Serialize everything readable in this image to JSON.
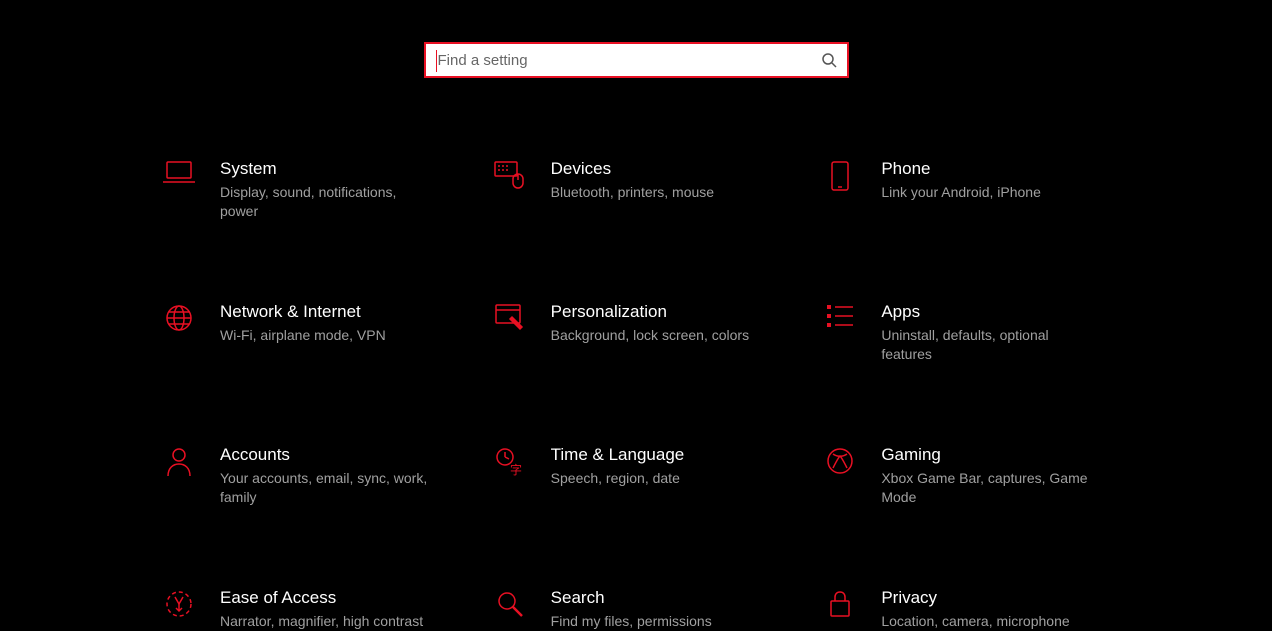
{
  "search": {
    "placeholder": "Find a setting"
  },
  "items": [
    {
      "title": "System",
      "desc": "Display, sound, notifications, power",
      "icon": "laptop"
    },
    {
      "title": "Devices",
      "desc": "Bluetooth, printers, mouse",
      "icon": "devices"
    },
    {
      "title": "Phone",
      "desc": "Link your Android, iPhone",
      "icon": "phone"
    },
    {
      "title": "Network & Internet",
      "desc": "Wi-Fi, airplane mode, VPN",
      "icon": "globe"
    },
    {
      "title": "Personalization",
      "desc": "Background, lock screen, colors",
      "icon": "personalize"
    },
    {
      "title": "Apps",
      "desc": "Uninstall, defaults, optional features",
      "icon": "apps"
    },
    {
      "title": "Accounts",
      "desc": "Your accounts, email, sync, work, family",
      "icon": "account"
    },
    {
      "title": "Time & Language",
      "desc": "Speech, region, date",
      "icon": "time-lang"
    },
    {
      "title": "Gaming",
      "desc": "Xbox Game Bar, captures, Game Mode",
      "icon": "gaming"
    },
    {
      "title": "Ease of Access",
      "desc": "Narrator, magnifier, high contrast",
      "icon": "ease"
    },
    {
      "title": "Search",
      "desc": "Find my files, permissions",
      "icon": "search"
    },
    {
      "title": "Privacy",
      "desc": "Location, camera, microphone",
      "icon": "privacy"
    }
  ],
  "icon_names": {
    "laptop": "laptop-icon",
    "devices": "keyboard-mouse-icon",
    "phone": "phone-icon",
    "globe": "globe-icon",
    "personalize": "paintbrush-icon",
    "apps": "list-icon",
    "account": "person-icon",
    "time-lang": "clock-language-icon",
    "gaming": "xbox-icon",
    "ease": "ease-of-access-icon",
    "search": "magnifier-icon",
    "privacy": "lock-icon"
  },
  "colors": {
    "accent": "#e81023",
    "bg": "#000000"
  }
}
